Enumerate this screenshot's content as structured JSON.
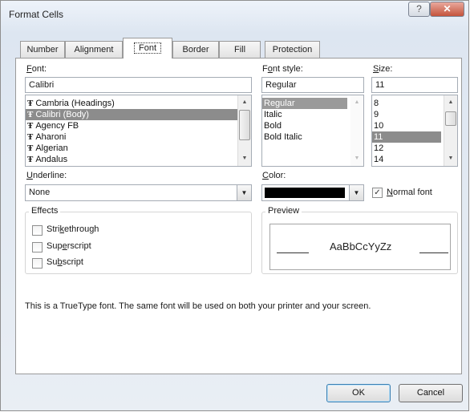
{
  "window": {
    "title": "Format Cells",
    "help_glyph": "?",
    "close_glyph": "✕"
  },
  "tabs": [
    "Number",
    "Alignment",
    "Font",
    "Border",
    "Fill",
    "Protection"
  ],
  "active_tab": "Font",
  "font": {
    "label": "Font:",
    "value": "Calibri",
    "items": [
      "Cambria (Headings)",
      "Calibri (Body)",
      "Agency FB",
      "Aharoni",
      "Algerian",
      "Andalus"
    ],
    "selected": "Calibri (Body)"
  },
  "font_style": {
    "label": "Font style:",
    "value": "Regular",
    "items": [
      "Regular",
      "Italic",
      "Bold",
      "Bold Italic"
    ],
    "selected": "Regular"
  },
  "size": {
    "label": "Size:",
    "value": "11",
    "items": [
      "8",
      "9",
      "10",
      "11",
      "12",
      "14"
    ],
    "selected": "11"
  },
  "underline": {
    "label": "Underline:",
    "value": "None"
  },
  "color": {
    "label": "Color:",
    "value": "#000000"
  },
  "normal_font": {
    "label": "Normal font",
    "checked": true
  },
  "effects": {
    "title": "Effects",
    "strikethrough": "Strikethrough",
    "superscript": "Superscript",
    "subscript": "Subscript"
  },
  "preview": {
    "title": "Preview",
    "sample": "AaBbCcYyZz"
  },
  "info_text": "This is a TrueType font.  The same font will be used on both your printer and your screen.",
  "buttons": {
    "ok": "OK",
    "cancel": "Cancel"
  }
}
